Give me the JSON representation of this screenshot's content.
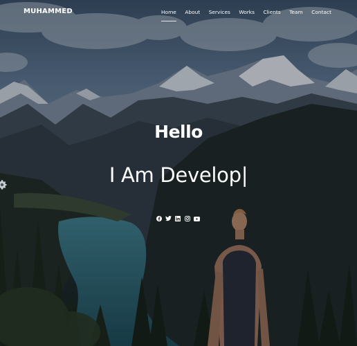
{
  "brand": {
    "name": "MUHAMMED"
  },
  "nav": {
    "items": [
      {
        "label": "Home",
        "active": true
      },
      {
        "label": "About"
      },
      {
        "label": "Services"
      },
      {
        "label": "Works"
      },
      {
        "label": "Clients"
      },
      {
        "label": "Team"
      },
      {
        "label": "Contact"
      }
    ]
  },
  "hero": {
    "greeting": "Hello",
    "typed_text": "I Am Develop|"
  },
  "social": [
    "facebook-icon",
    "twitter-icon",
    "linkedin-icon",
    "instagram-icon",
    "youtube-icon"
  ],
  "settings": {
    "icon": "gear-icon"
  }
}
